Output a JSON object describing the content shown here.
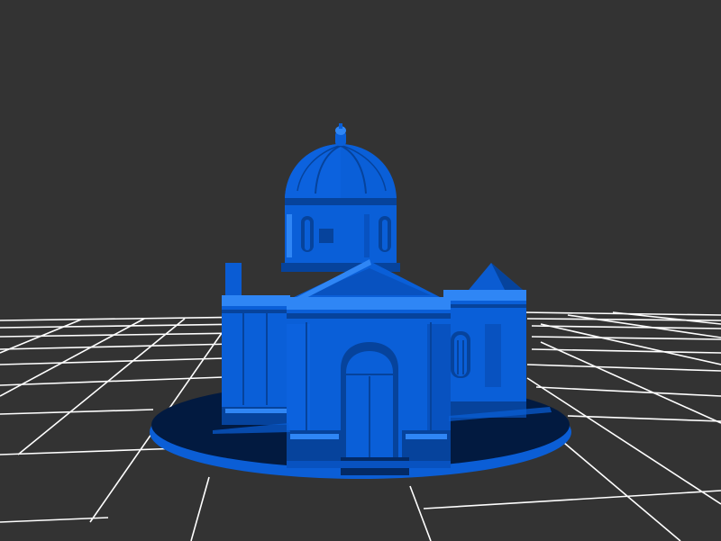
{
  "viewport": {
    "background_color": "#333333",
    "grid_color": "#ffffff"
  },
  "model": {
    "subject": "domed-chapel",
    "base_color": "#0a5fd8",
    "shadow_color": "#06439c",
    "dark_color": "#032a66",
    "highlight_color": "#2f86f5"
  }
}
